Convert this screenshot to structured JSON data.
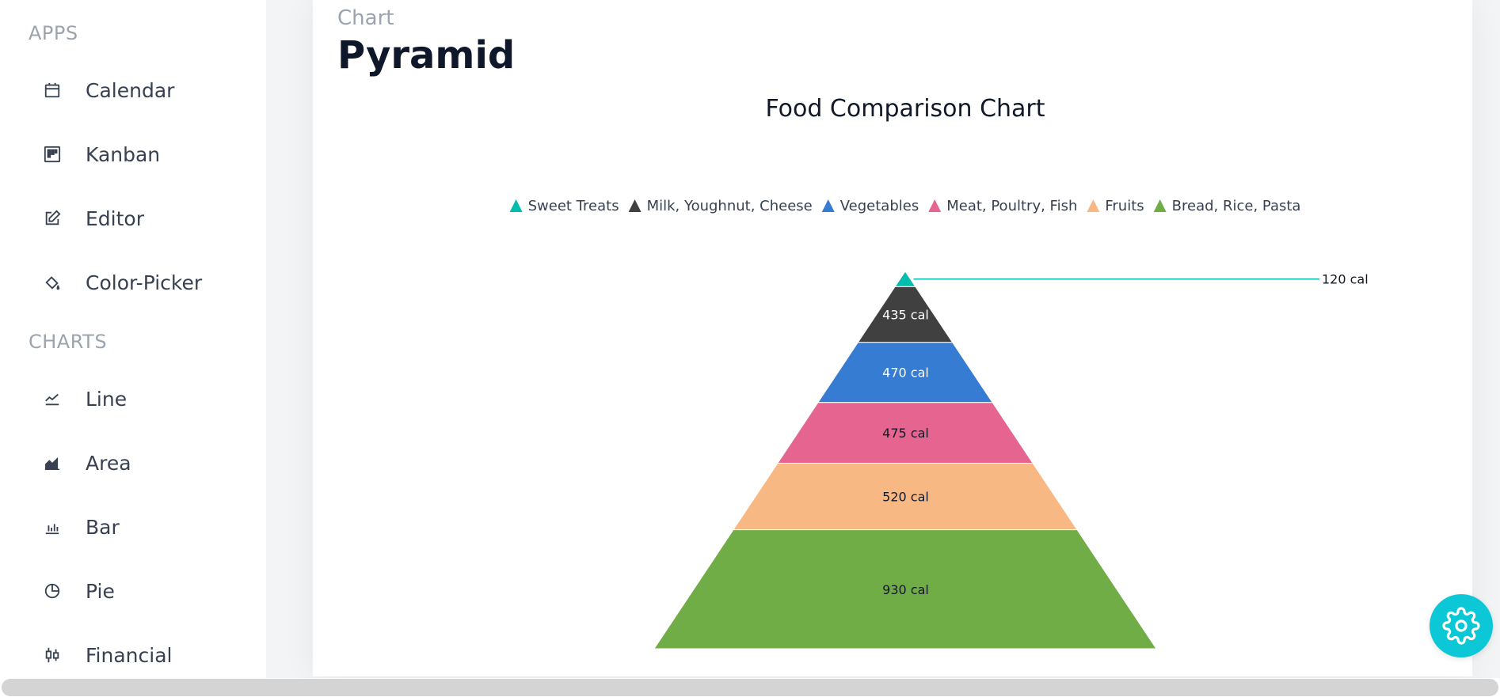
{
  "sidebar": {
    "sections": [
      {
        "title": "APPS",
        "items": [
          {
            "label": "Calendar",
            "icon": "calendar-icon"
          },
          {
            "label": "Kanban",
            "icon": "kanban-icon"
          },
          {
            "label": "Editor",
            "icon": "edit-icon"
          },
          {
            "label": "Color-Picker",
            "icon": "paint-bucket-icon"
          }
        ]
      },
      {
        "title": "CHARTS",
        "items": [
          {
            "label": "Line",
            "icon": "line-chart-icon"
          },
          {
            "label": "Area",
            "icon": "area-chart-icon"
          },
          {
            "label": "Bar",
            "icon": "bar-chart-icon"
          },
          {
            "label": "Pie",
            "icon": "pie-chart-icon"
          },
          {
            "label": "Financial",
            "icon": "candlestick-icon"
          }
        ]
      }
    ]
  },
  "header": {
    "breadcrumb": "Chart",
    "title": "Pyramid"
  },
  "chart_data": {
    "type": "pyramid",
    "title": "Food Comparison Chart",
    "legend_position": "top",
    "unit": "cal",
    "segments": [
      {
        "name": "Sweet Treats",
        "value": 120,
        "label": "120 cal",
        "color": "#00bdae"
      },
      {
        "name": "Milk, Youghnut, Cheese",
        "value": 435,
        "label": "435 cal",
        "color": "#404041"
      },
      {
        "name": "Vegetables",
        "value": 470,
        "label": "470 cal",
        "color": "#357cd2"
      },
      {
        "name": "Meat, Poultry, Fish",
        "value": 475,
        "label": "475 cal",
        "color": "#e56590"
      },
      {
        "name": "Fruits",
        "value": 520,
        "label": "520 cal",
        "color": "#f8b883"
      },
      {
        "name": "Bread, Rice, Pasta",
        "value": 930,
        "label": "930 cal",
        "color": "#70ad47"
      }
    ]
  },
  "colors": {
    "accent": "#0cc7d6"
  }
}
